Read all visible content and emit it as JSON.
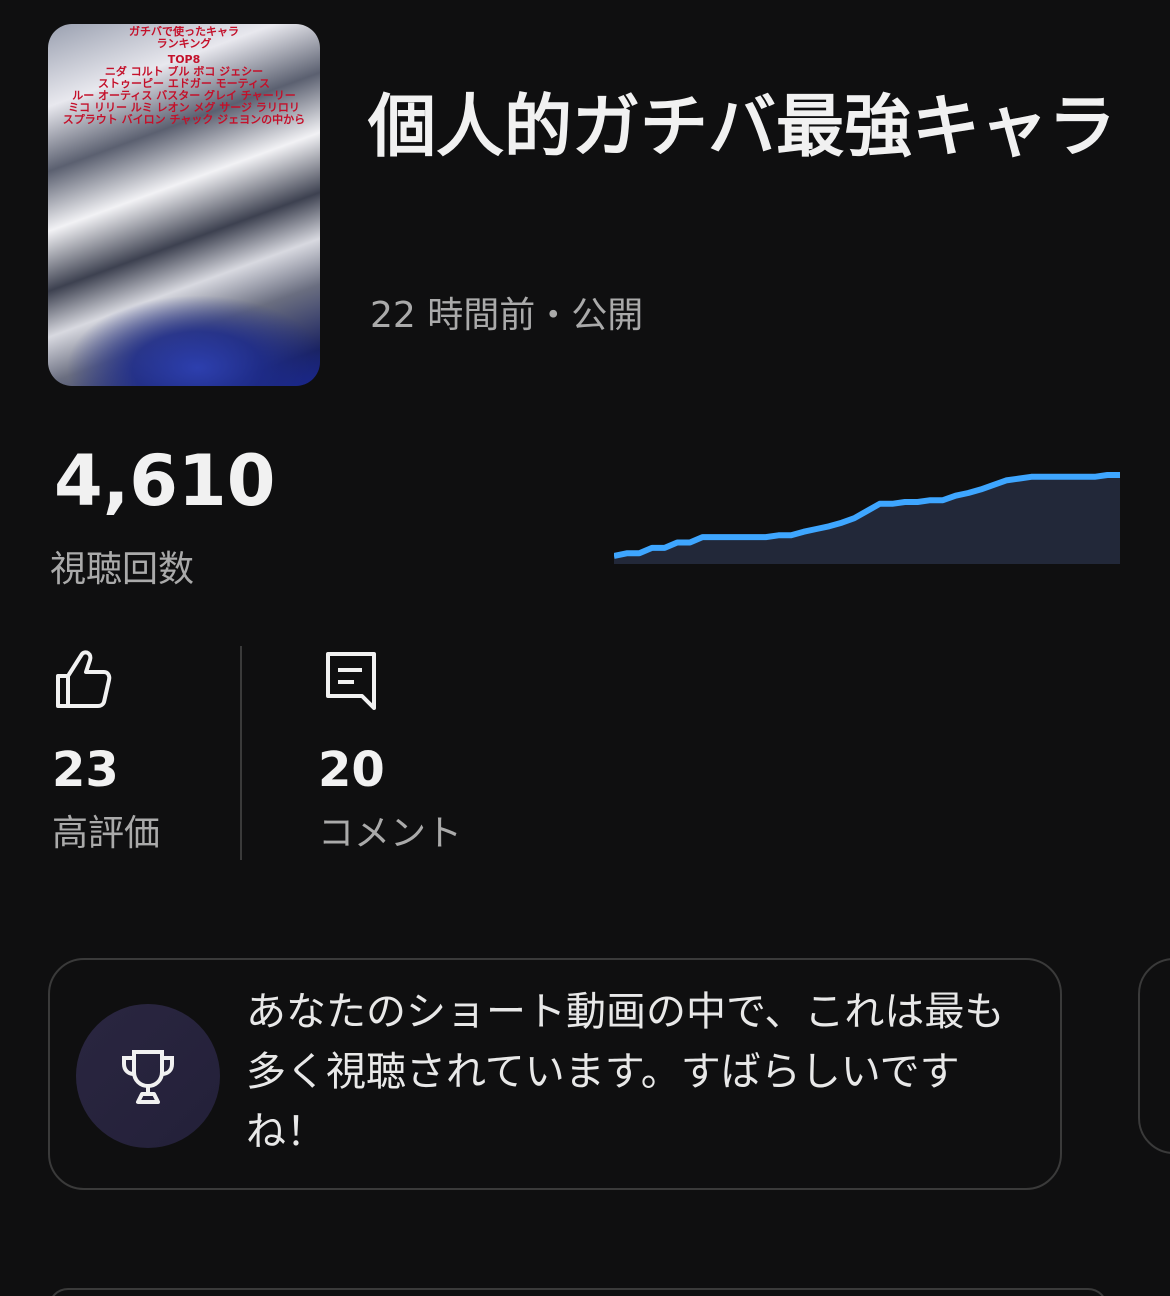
{
  "video": {
    "thumbnail_lines": [
      "ガチバで使ったキャラ",
      "ランキング",
      "TOP8",
      "ニダ コルト ブル ボコ ジェシー",
      "ストゥーピー エドガー モーティス",
      "ルー オーティス バスター グレイ チャーリー",
      "ミコ リリー ルミ レオン メグ サージ ラリロリ",
      "スプラウト バイロン チャック ジェヨンの中から"
    ],
    "title": "個人的ガチバ最強キャラ",
    "meta": "22 時間前・公開"
  },
  "views": {
    "count": "4,610",
    "label": "視聴回数"
  },
  "sparkline": {
    "type": "line",
    "line_color": "#3ea6ff",
    "fill_color": "#222839",
    "values": [
      0,
      3,
      3,
      9,
      9,
      15,
      15,
      21,
      21,
      21,
      21,
      21,
      21,
      23,
      23,
      27,
      30,
      33,
      37,
      42,
      50,
      58,
      58,
      60,
      60,
      62,
      62,
      67,
      70,
      74,
      79,
      84,
      86,
      88,
      88,
      88,
      88,
      88,
      88,
      90,
      90
    ]
  },
  "stats": {
    "likes": {
      "value": "23",
      "label": "高評価",
      "icon": "thumbs-up-icon"
    },
    "comments": {
      "value": "20",
      "label": "コメント",
      "icon": "comment-icon"
    }
  },
  "card": {
    "icon": "trophy-icon",
    "text": "あなたのショート動画の中で、これは最も多く視聴されています。すばらしいですね！"
  }
}
